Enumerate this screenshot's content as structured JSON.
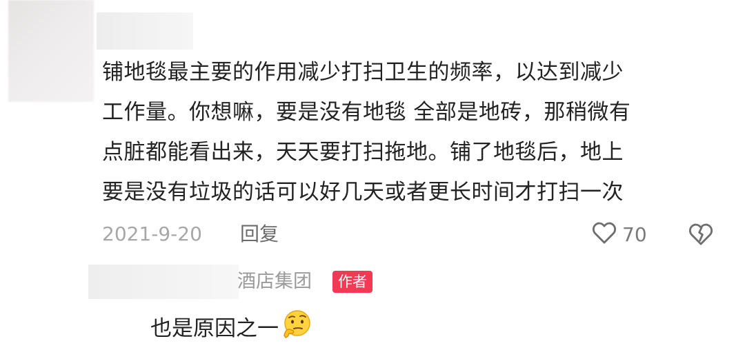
{
  "comment": {
    "lines": [
      "铺地毯最主要的作用减少打扫卫生的频率，以达到减少",
      "工作量。你想嘛，要是没有地毯 全部是地砖，那稍微有",
      "点脏都能看出来，天天要打扫拖地。铺了地毯后，地上",
      "要是没有垃圾的话可以好几天或者更长时间才打扫一次"
    ],
    "date": "2021-9-20",
    "reply_label": "回复",
    "like_count": "70"
  },
  "reply": {
    "username_suffix": "酒店集团",
    "badge": "作者",
    "text": "也是原因之一"
  },
  "icons": {
    "like": "heart-outline-icon",
    "dislike": "broken-heart-icon",
    "emoji": "thinking-face-emoji"
  },
  "colors": {
    "badge": "#f23a54",
    "text": "#222222",
    "muted": "#a7a7a7"
  }
}
